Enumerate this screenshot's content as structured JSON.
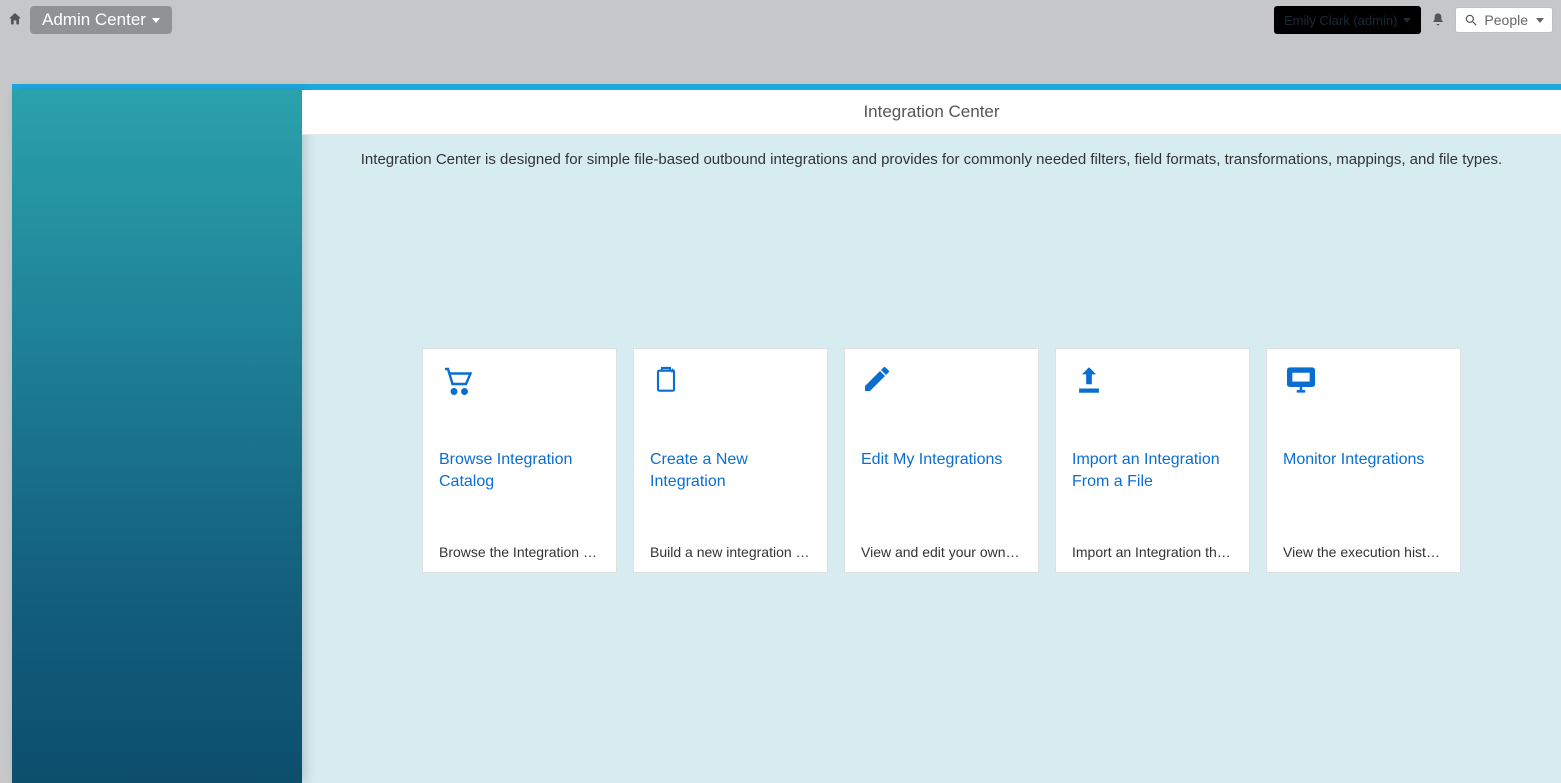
{
  "header": {
    "module_label": "Admin Center",
    "user_display": "Emily Clark (admin)",
    "search_scope": "People"
  },
  "page": {
    "title": "Integration Center",
    "intro": "Integration Center is designed for simple file-based outbound integrations and provides for commonly needed filters, field formats, transformations, mappings, and file types."
  },
  "cards": [
    {
      "title": "Browse Integration Catalog",
      "desc": "Browse the Integration Catalog for pre-built templates."
    },
    {
      "title": "Create a New Integration",
      "desc": "Build a new integration from scratch."
    },
    {
      "title": "Edit My Integrations",
      "desc": "View and edit your own integrations."
    },
    {
      "title": "Import an Integration From a File",
      "desc": "Import an Integration that was previously exported."
    },
    {
      "title": "Monitor Integrations",
      "desc": "View the execution history of integrations."
    }
  ]
}
